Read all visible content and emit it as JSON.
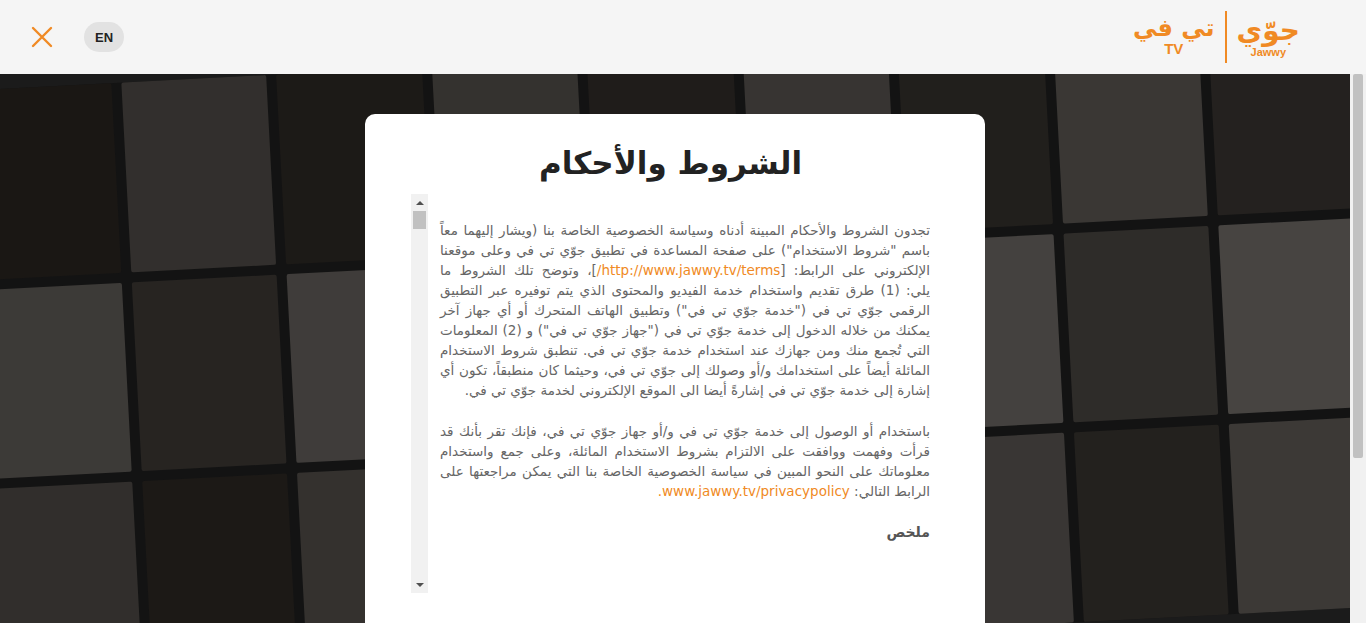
{
  "header": {
    "language": "EN",
    "logo": {
      "brand_ar": "جوّي",
      "brand_en": "Jawwy",
      "tv_ar": "تي في",
      "tv_en": "TV"
    }
  },
  "dialog": {
    "title": "الشروط والأحكام",
    "paragraphs": [
      {
        "kind": "body",
        "segments": [
          {
            "kind": "text",
            "text": "تجدون الشروط والأحكام المبينة أدناه وسياسة الخصوصية الخاصة بنا (ويشار إليهما معاً باسم \"شروط الاستخدام\") على صفحة المساعدة في تطبيق جوّي تي في وعلى موقعنا الإلكتروني على الرابط: ["
          },
          {
            "kind": "link",
            "text": "http://www.jawwy.tv/terms/"
          },
          {
            "kind": "text",
            "text": "]، وتوضح تلك الشروط ما يلي: (1) طرق تقديم واستخدام خدمة الفيديو والمحتوى الذي يتم توفيره عبر التطبيق الرقمي جوّي تي في (\"خدمة جوّي تي في\") وتطبيق الهاتف المتحرك أو أي جهاز آخر يمكنك من خلاله الدخول إلى خدمة جوّي تي في (\"جهاز جوّي تي في\") و (2) المعلومات التي تُجمع منك ومن جهازك عند استخدام خدمة جوّي تي في. تنطبق شروط الاستخدام المائلة أيضاً على استخدامك و/أو وصولك إلى جوّي تي في، وحيثما كان منطبقاً، تكون أي إشارة إلى خدمة جوّي تي في إشارةً أيضا الى الموقع الإلكتروني لخدمة جوّي تي في."
          }
        ]
      },
      {
        "kind": "body",
        "segments": [
          {
            "kind": "text",
            "text": "باستخدام أو الوصول إلى خدمة جوّي تي في و/أو جهاز جوّي تي في، فإنك تقر بأنك قد قرأت وفهمت ووافقت على الالتزام بشروط الاستخدام المائلة، وعلى جمع واستخدام معلوماتك على النحو المبين في سياسة الخصوصية الخاصة بنا التي يمكن مراجعتها على الرابط التالي: "
          },
          {
            "kind": "link",
            "text": "www.jawwy.tv/privacypolicy."
          }
        ]
      },
      {
        "kind": "heading",
        "segments": [
          {
            "kind": "text",
            "text": "ملخص"
          }
        ]
      }
    ],
    "scrollbar": {
      "position": 0,
      "thumb": 0.05
    }
  },
  "page_scrollbar": {
    "position": 0,
    "thumb": 0.7
  }
}
